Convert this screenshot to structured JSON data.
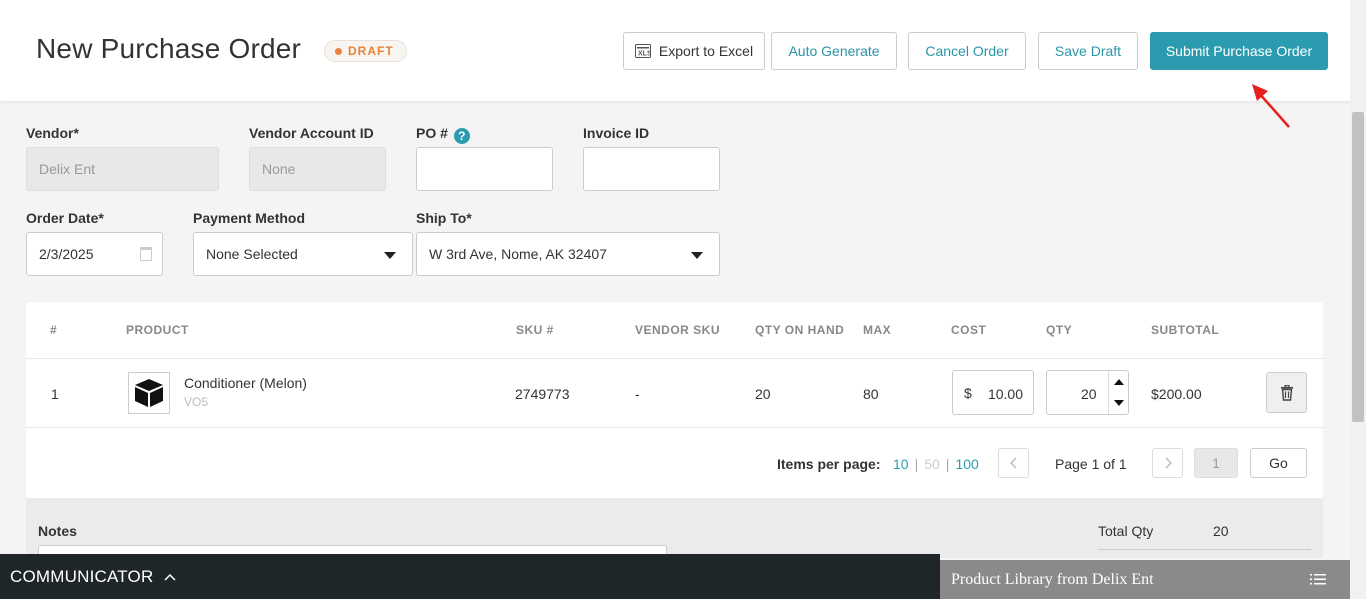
{
  "header": {
    "title": "New Purchase Order",
    "status_badge": "DRAFT",
    "buttons": {
      "export": "Export to Excel",
      "auto_generate": "Auto Generate",
      "cancel": "Cancel Order",
      "save_draft": "Save Draft",
      "submit": "Submit Purchase Order"
    }
  },
  "form": {
    "vendor": {
      "label": "Vendor*",
      "value": "Delix Ent"
    },
    "vendor_account": {
      "label": "Vendor Account ID",
      "value": "None"
    },
    "po_number": {
      "label": "PO #",
      "help": "?",
      "value": ""
    },
    "invoice_id": {
      "label": "Invoice ID",
      "value": ""
    },
    "order_date": {
      "label": "Order Date*",
      "value": "2/3/2025"
    },
    "payment_method": {
      "label": "Payment Method",
      "value": "None Selected"
    },
    "ship_to": {
      "label": "Ship To*",
      "value": "W 3rd Ave, Nome, AK 32407"
    }
  },
  "table": {
    "columns": [
      "#",
      "PRODUCT",
      "SKU #",
      "VENDOR SKU",
      "QTY ON HAND",
      "MAX",
      "COST",
      "QTY",
      "SUBTOTAL"
    ],
    "rows": [
      {
        "index": "1",
        "product_name": "Conditioner (Melon)",
        "product_brand": "VO5",
        "sku": "2749773",
        "vendor_sku": "-",
        "qty_on_hand": "20",
        "max": "80",
        "cost_currency": "$",
        "cost": "10.00",
        "qty": "20",
        "subtotal": "$200.00"
      }
    ],
    "pagination": {
      "items_per_page_label": "Items per page:",
      "options": [
        "10",
        "50",
        "100"
      ],
      "separator": "|",
      "page_label": "Page 1 of 1",
      "page_input": "1",
      "go_label": "Go"
    }
  },
  "notes": {
    "label": "Notes"
  },
  "totals": {
    "total_qty_label": "Total Qty",
    "total_qty_value": "20"
  },
  "footer": {
    "communicator": "COMMUNICATOR",
    "product_library": "Product Library from Delix Ent"
  },
  "colors": {
    "accent": "#2b9cb0",
    "draft": "#e8833a",
    "arrow": "#e8201c"
  },
  "icons": [
    "excel-icon",
    "help-icon",
    "calendar-icon",
    "chevron-down-icon",
    "product-box-icon",
    "spinner-up-icon",
    "spinner-down-icon",
    "trash-icon",
    "chevron-left-icon",
    "chevron-right-icon",
    "chevron-up-icon",
    "list-icon",
    "annotation-arrow"
  ]
}
